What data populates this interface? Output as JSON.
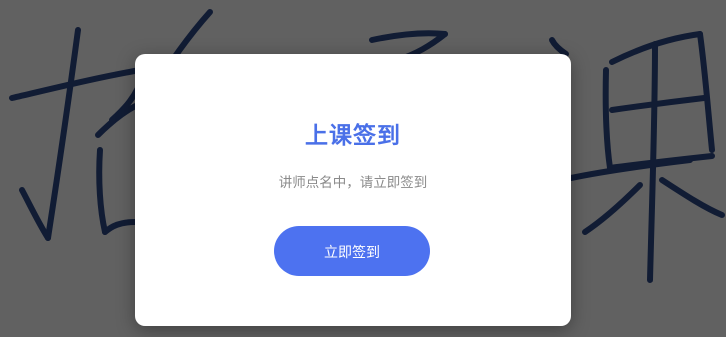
{
  "modal": {
    "title": "上课签到",
    "subtitle": "讲师点名中，请立即签到",
    "button_label": "立即签到"
  },
  "colors": {
    "accent": "#4d72f0",
    "title": "#4a70e8",
    "overlay": "rgba(0,0,0,0.62)",
    "ink": "#2f4a8a"
  },
  "background": {
    "handwriting": [
      "推",
      "子",
      "课"
    ]
  }
}
